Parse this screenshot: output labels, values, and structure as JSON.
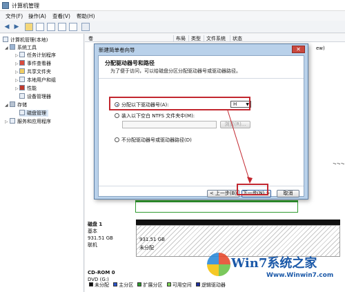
{
  "window": {
    "title": "计算机管理"
  },
  "menu": [
    "文件(F)",
    "操作(A)",
    "查看(V)",
    "帮助(H)"
  ],
  "tree": {
    "root": "计算机管理(本地)",
    "system_tools": "系统工具",
    "items": [
      "任务计划程序",
      "事件查看器",
      "共享文件夹",
      "本地用户和组",
      "性能",
      "设备管理器"
    ],
    "storage": "存储",
    "disk_mgmt": "磁盘管理",
    "services": "服务和应用程序"
  },
  "columns": [
    "卷",
    "布局",
    "类型",
    "文件系统",
    "状态"
  ],
  "right_bg": [
    "ew)",
    "",
    "",
    "",
    "",
    "",
    "",
    "",
    "",
    "",
    "",
    "",
    "",
    ">>>"
  ],
  "dialog": {
    "title": "新建简单卷向导",
    "close": "✕",
    "heading": "分配驱动器号和路径",
    "subheading": "为了便于访问，可以给磁盘分区分配驱动器号或驱动器路径。",
    "opt1": "分配以下驱动器号(A):",
    "drive_value": "H",
    "opt2": "装入以下空白 NTFS 文件夹中(M):",
    "browse": "浏览(R)...",
    "opt3": "不分配驱动器号或驱动器路径(D)",
    "back": "< 上一步(B)",
    "next": "下一步(N) >",
    "cancel": "取消"
  },
  "disk1": {
    "name": "磁盘 1",
    "type": "基本",
    "size": "931.51 GB",
    "status": "联机",
    "part_size": "931.51 GB",
    "part_status": "未分配"
  },
  "cdrom": {
    "name": "CD-ROM 0",
    "drive": "DVD (G:)"
  },
  "legend": [
    "未分配",
    "主分区",
    "扩展分区",
    "可用空间",
    "逻辑驱动器"
  ],
  "legend_colors": [
    "#111111",
    "#2c55c8",
    "#2e9a2e",
    "#7ccf57",
    "#1c2e9e"
  ],
  "watermark": {
    "brand": "Win7系统之家",
    "url": "Www.Winwin7.com"
  }
}
